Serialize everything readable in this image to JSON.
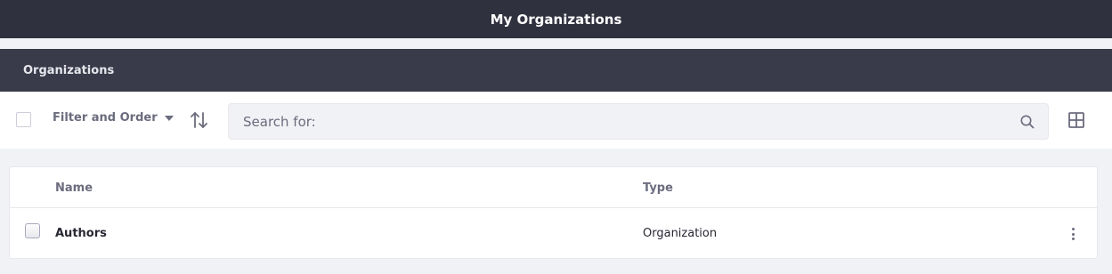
{
  "header": {
    "title": "My Organizations"
  },
  "nav": {
    "label": "Organizations"
  },
  "toolbar": {
    "filter_order_label": "Filter and Order",
    "search_placeholder": "Search for:"
  },
  "table": {
    "columns": [
      "Name",
      "Type"
    ],
    "rows": [
      {
        "name": "Authors",
        "type": "Organization"
      }
    ]
  },
  "icons": {
    "filter": "caret-down-icon",
    "sort": "sort-arrows-icon",
    "search": "search-icon",
    "view": "grid-view-icon",
    "actions": "kebab-menu-icon"
  },
  "colors": {
    "header_bg": "#30313f",
    "nav_bg": "#393a4a",
    "page_bg": "#f1f2f5",
    "text": "#272833",
    "secondary_text": "#6b6c7e"
  }
}
